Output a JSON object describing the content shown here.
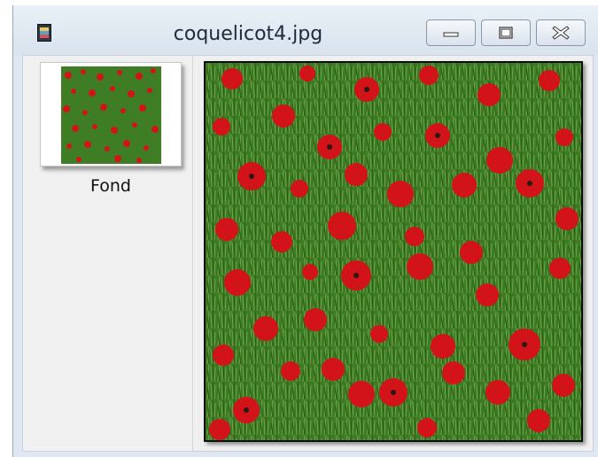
{
  "window": {
    "title": "coquelicot4.jpg",
    "icon": "image-file-icon",
    "controls": {
      "minimize": "minimize-icon",
      "maximize": "maximize-icon",
      "close": "close-icon"
    }
  },
  "sidebar": {
    "items": [
      {
        "label": "Fond",
        "thumbnail": "poppy-field-thumbnail"
      }
    ]
  },
  "colors": {
    "poppy_red": "#d3131a",
    "grass_green": "#3f7d25",
    "window_frame": "#dfe8f2"
  }
}
